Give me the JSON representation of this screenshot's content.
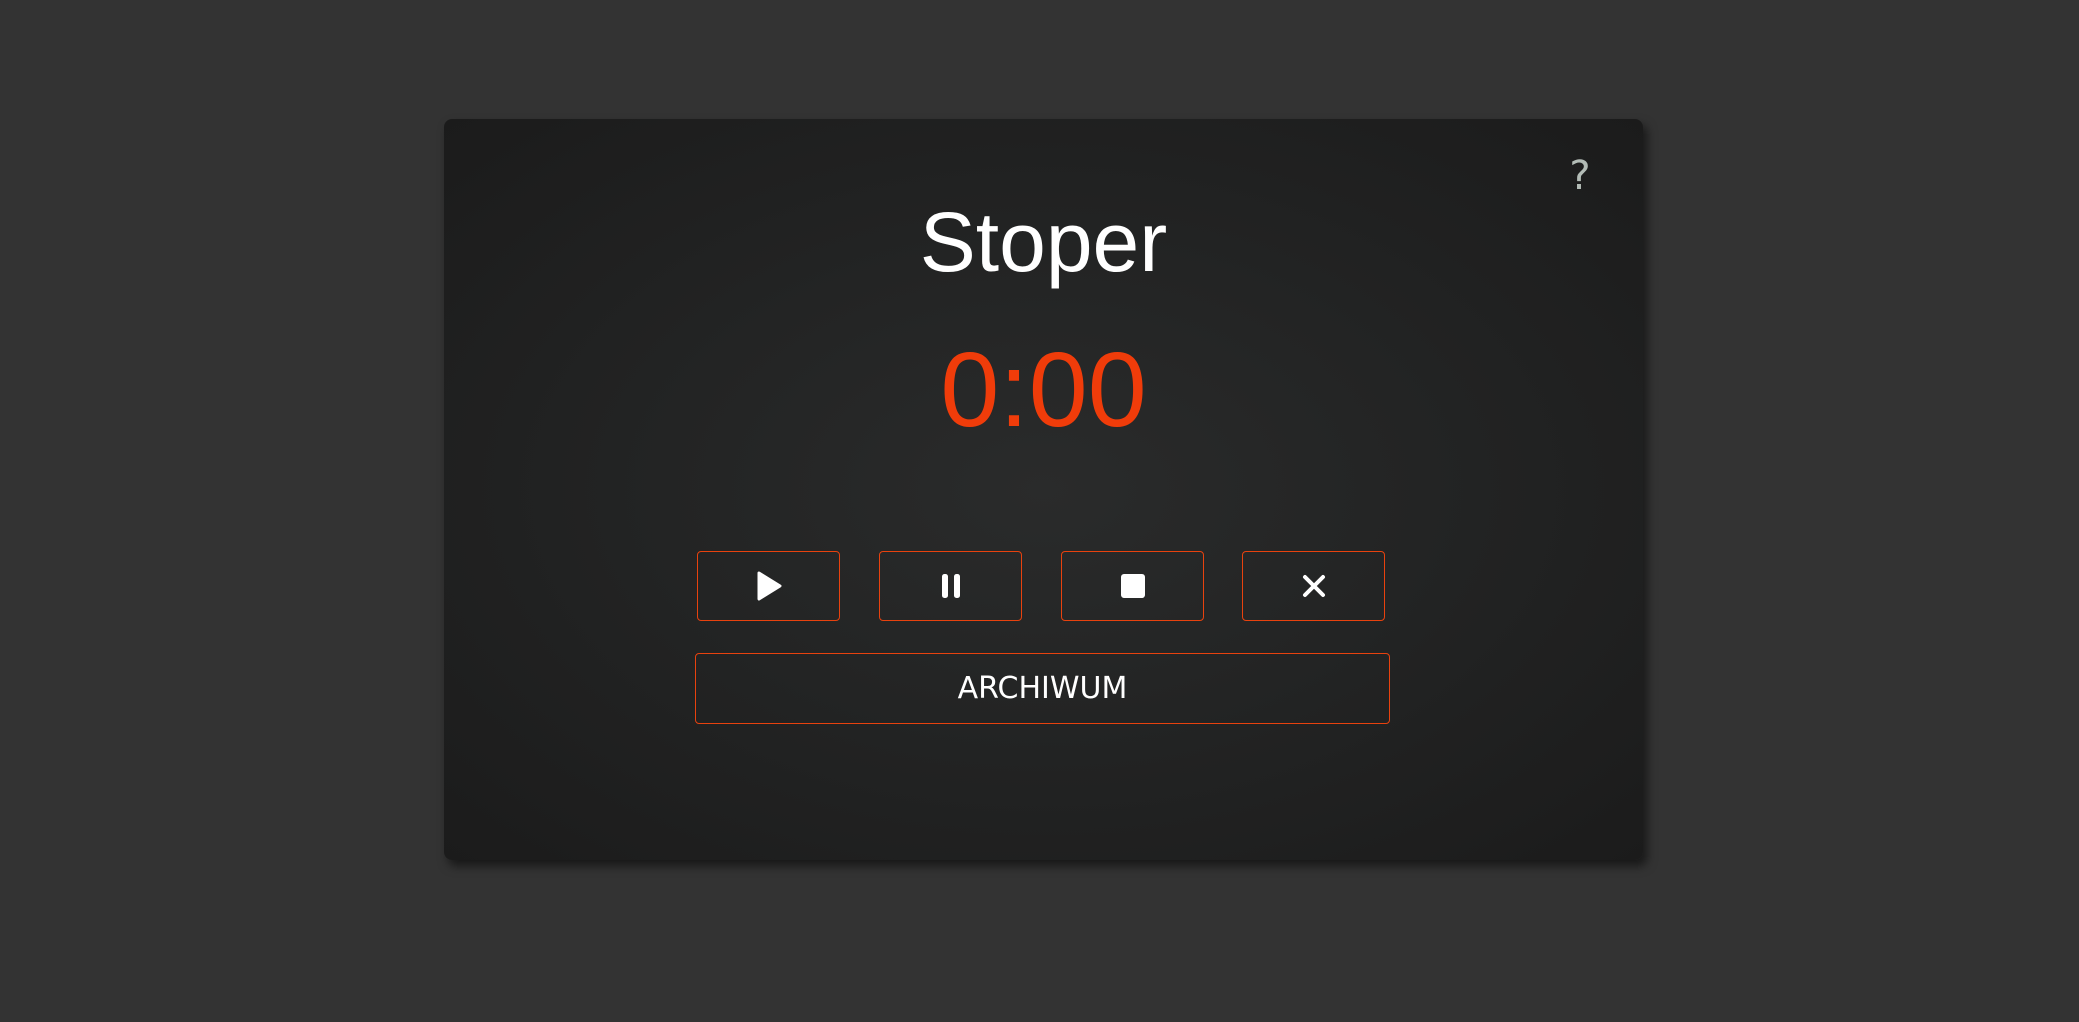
{
  "app": {
    "title": "Stoper",
    "time": "0:00",
    "help_label": "?"
  },
  "controls": [
    {
      "name": "play",
      "icon": "play-icon"
    },
    {
      "name": "pause",
      "icon": "pause-icon"
    },
    {
      "name": "stop",
      "icon": "stop-icon"
    },
    {
      "name": "reset",
      "icon": "close-icon"
    }
  ],
  "archive": {
    "label": "ARCHIWUM"
  },
  "colors": {
    "accent": "#f03c0a",
    "border": "#e8420e",
    "background": "#333333",
    "card": "#1e1f1f"
  }
}
